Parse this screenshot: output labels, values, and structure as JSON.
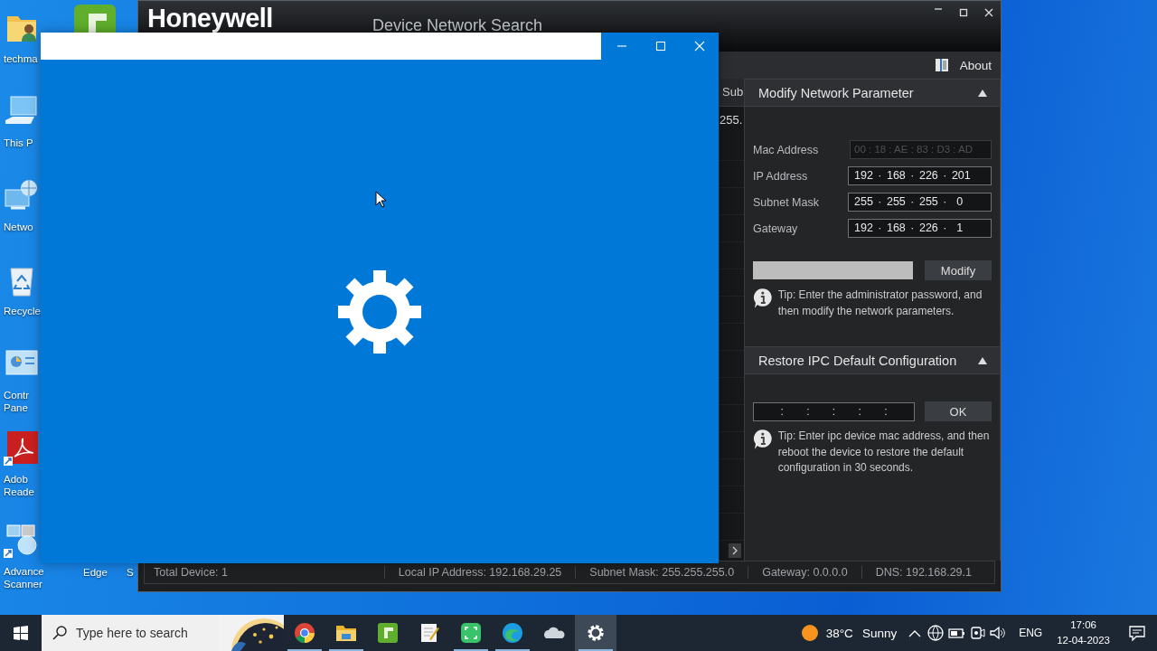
{
  "desktop": {
    "icons": [
      {
        "kind": "user-folder",
        "label": "techma"
      },
      {
        "kind": "pc",
        "label": "This P"
      },
      {
        "kind": "network",
        "label": "Netwo"
      },
      {
        "kind": "recycle-bin",
        "label": "Recycle"
      },
      {
        "kind": "control-panel",
        "label": "Contr Pane"
      },
      {
        "kind": "pdf",
        "label": "Adob Reade"
      },
      {
        "kind": "scanner",
        "label": "Advance Scanner"
      },
      {
        "kind": "recorder"
      },
      {
        "kind": "none",
        "label": "Edge"
      },
      {
        "kind": "none",
        "label": "S"
      }
    ]
  },
  "app_window": {
    "logo": "Honeywell",
    "title": "Device Network Search",
    "toolbar": {
      "about": "About"
    },
    "grid": {
      "column_1": "Sub",
      "rows": [
        {
          "column_1": "255."
        }
      ]
    },
    "modify_panel": {
      "title": "Modify Network Parameter",
      "expanded": true,
      "fields": [
        {
          "label": "Mac Address",
          "value": "00 : 18 : AE : 83 : D3 : AD",
          "disabled": true
        },
        {
          "label": "IP Address",
          "value": "192 · 168 · 226 · 201",
          "disabled": false
        },
        {
          "label": "Subnet Mask",
          "value": "255 · 255 · 255 ·  0",
          "disabled": false
        },
        {
          "label": "Gateway",
          "value": "192 · 168 · 226 ·  1",
          "disabled": false
        }
      ],
      "button": "Modify",
      "tip": "Tip: Enter the administrator password, and then modify the network parameters."
    },
    "restore_panel": {
      "title": "Restore IPC Default Configuration",
      "expanded": true,
      "value": ":    :    :    :    :",
      "button": "OK",
      "tip": "Tip: Enter ipc device mac address, and then reboot the device to restore the default configuration in 30 seconds."
    },
    "status_bar": [
      "Total Device: 1",
      "Local IP Address: 192.168.29.25",
      "Subnet Mask: 255.255.255.0",
      "Gateway: 0.0.0.0",
      "DNS: 192.168.29.1"
    ]
  },
  "taskbar": {
    "search": {
      "placeholder": "Type here to search"
    },
    "apps": [
      {
        "kind": "browser",
        "running": true,
        "selected": false
      },
      {
        "kind": "folder",
        "running": true,
        "selected": false
      },
      {
        "kind": "recorder",
        "running": false,
        "selected": false
      },
      {
        "kind": "notepad",
        "running": false,
        "selected": false
      },
      {
        "kind": "capture",
        "running": true,
        "selected": false
      },
      {
        "kind": "edge",
        "running": true,
        "selected": false
      },
      {
        "kind": "cloud",
        "running": false,
        "selected": false
      },
      {
        "kind": "settings",
        "running": true,
        "selected": true
      }
    ],
    "weather": {
      "temperature": "38°C",
      "condition": "Sunny"
    },
    "language": "ENG",
    "time": "17:06",
    "date": "12-04-2023"
  }
}
